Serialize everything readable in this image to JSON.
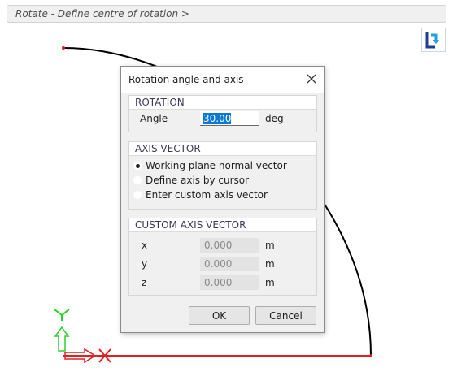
{
  "command_bar": {
    "text": "Rotate - Define centre of rotation >"
  },
  "dialog": {
    "title": "Rotation angle and axis",
    "rotation": {
      "header": "ROTATION",
      "angle_label": "Angle",
      "angle_value": "30.00",
      "angle_unit": "deg"
    },
    "axis_vector": {
      "header": "AXIS VECTOR",
      "options": [
        {
          "label": "Working plane normal vector",
          "selected": true
        },
        {
          "label": "Define axis by cursor",
          "selected": false
        },
        {
          "label": "Enter custom axis vector",
          "selected": false
        }
      ]
    },
    "custom_axis": {
      "header": "CUSTOM AXIS VECTOR",
      "rows": [
        {
          "label": "x",
          "value": "0.000",
          "unit": "m"
        },
        {
          "label": "y",
          "value": "0.000",
          "unit": "m"
        },
        {
          "label": "z",
          "value": "0.000",
          "unit": "m"
        }
      ]
    },
    "ok_label": "OK",
    "cancel_label": "Cancel"
  },
  "colors": {
    "curve": "#000000",
    "selection": "#e02020",
    "axis_x": "#e02020",
    "axis_y": "#2bd12b",
    "accent": "#0a78d4"
  },
  "icons": {
    "logo": "app-logo-icon",
    "close": "close-icon"
  }
}
